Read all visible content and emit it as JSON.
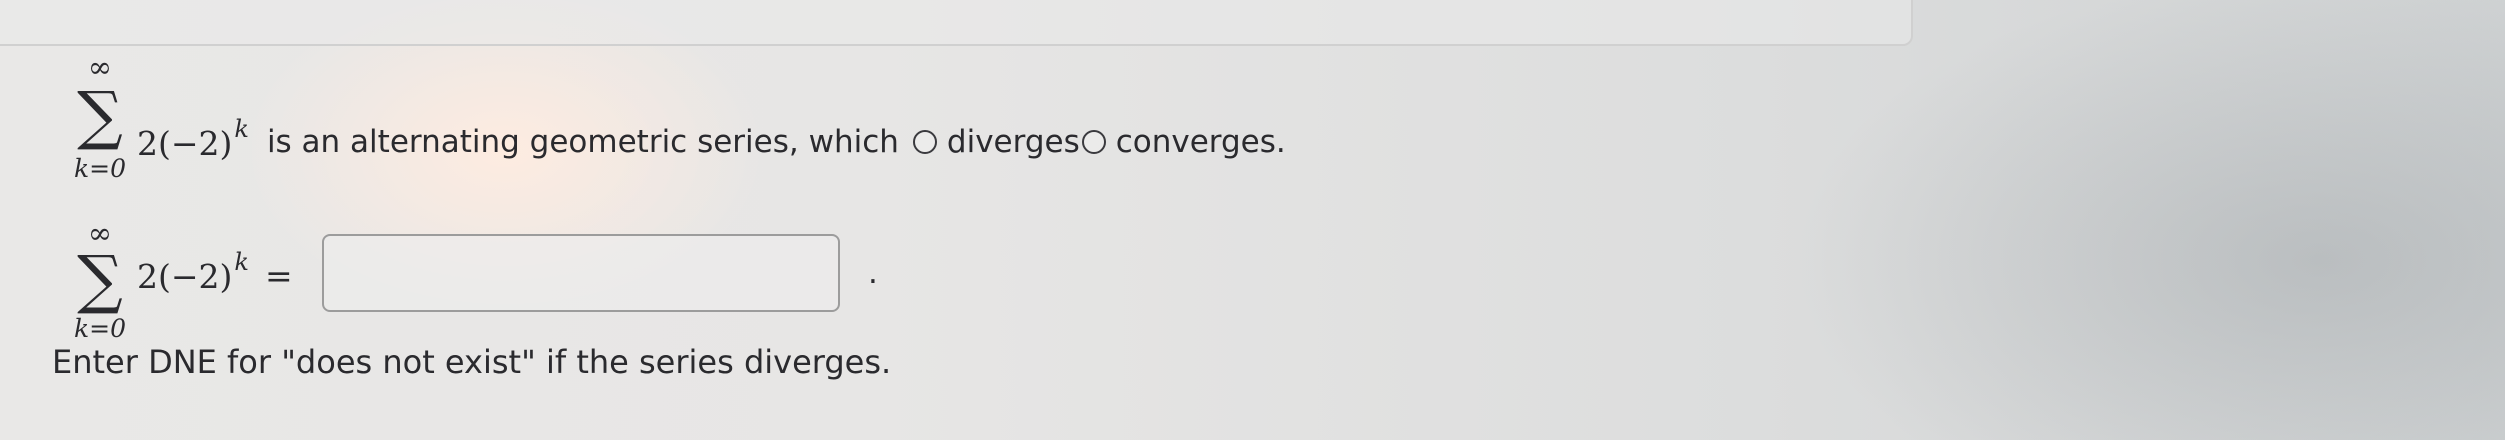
{
  "question": {
    "sum": {
      "upper": "∞",
      "symbol": "∑",
      "lower": "k=0",
      "term_base": "2(−2)",
      "term_exponent": "k"
    },
    "line1": {
      "text_before_options": "is an alternating geometric series, which",
      "option_diverges": "diverges",
      "option_converges": "converges."
    },
    "line2": {
      "equals": "=",
      "answer_value": "",
      "trailing_period": "."
    },
    "instruction": "Enter DNE for \"does not exist\" if the series diverges."
  },
  "colors": {
    "text": "#2a2a2e",
    "input_border": "#9c9c9c",
    "background": "#e8e7e6"
  }
}
